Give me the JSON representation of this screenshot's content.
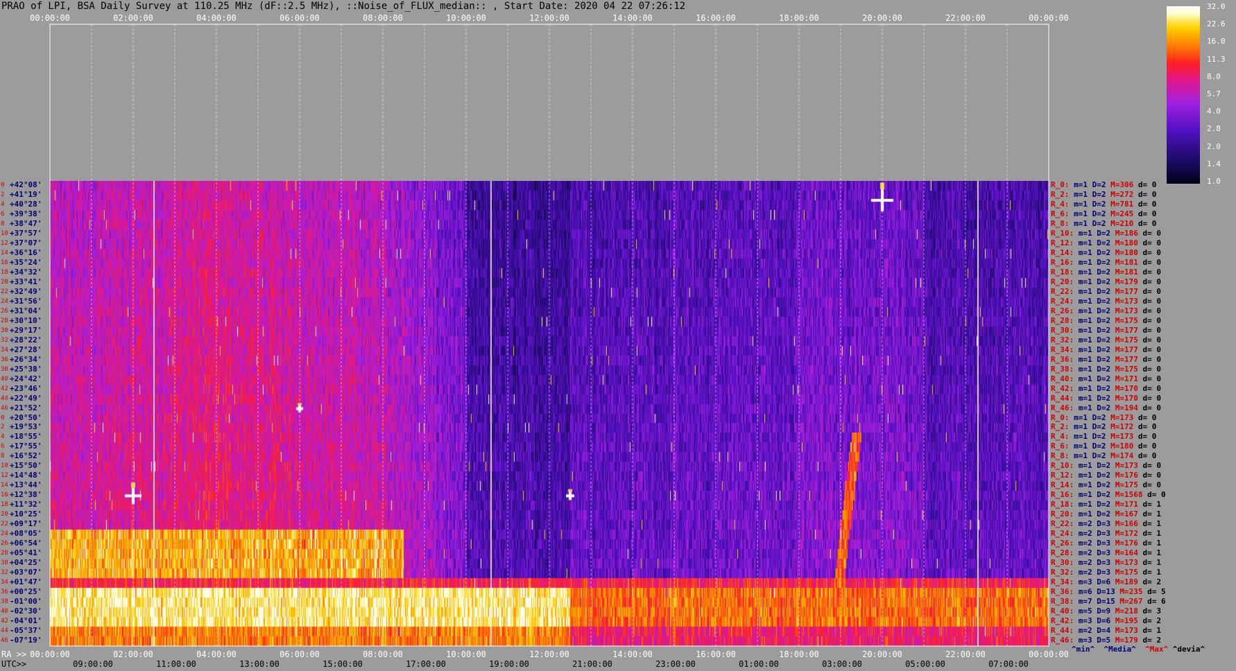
{
  "title": "PRAO of LPI, BSA Daily Survey at 110.25 MHz (dF::2.5 MHz), ::Noise_of_FLUX_median:: , Start Date: 2020 04 22 07:26:12",
  "top_axis_ticks": [
    "00:00:00",
    "02:00:00",
    "04:00:00",
    "06:00:00",
    "08:00:00",
    "10:00:00",
    "12:00:00",
    "14:00:00",
    "16:00:00",
    "18:00:00",
    "20:00:00",
    "22:00:00",
    "00:00:00"
  ],
  "ra_axis": {
    "label": "RA >>",
    "ticks": [
      "00:00:00",
      "02:00:00",
      "04:00:00",
      "06:00:00",
      "08:00:00",
      "10:00:00",
      "12:00:00",
      "14:00:00",
      "16:00:00",
      "18:00:00",
      "20:00:00",
      "22:00:00",
      "00:00:00"
    ]
  },
  "utc_axis": {
    "label": "UTC>>",
    "ticks": [
      "09:00:00",
      "11:00:00",
      "13:00:00",
      "15:00:00",
      "17:00:00",
      "19:00:00",
      "21:00:00",
      "23:00:00",
      "01:00:00",
      "03:00:00",
      "05:00:00",
      "07:00:00"
    ]
  },
  "colorbar": {
    "ticks": [
      "32.0",
      "22.6",
      "16.0",
      "11.3",
      "8.0",
      "5.7",
      "4.0",
      "2.8",
      "2.0",
      "1.4",
      "1.0"
    ]
  },
  "legend": {
    "min": "^min^",
    "media": "^Media^",
    "max": "^Max^",
    "devia": "^devia^"
  },
  "declinations": [
    "+42°08'",
    "+41°19'",
    "+40°28'",
    "+39°38'",
    "+38°47'",
    "+37°57'",
    "+37°07'",
    "+36°16'",
    "+35°24'",
    "+34°32'",
    "+33°41'",
    "+32°49'",
    "+31°56'",
    "+31°04'",
    "+30°10'",
    "+29°17'",
    "+28°22'",
    "+27°28'",
    "+26°34'",
    "+25°38'",
    "+24°42'",
    "+23°46'",
    "+22°49'",
    "+21°52'",
    "+20°50'",
    "+19°53'",
    "+18°55'",
    "+17°55'",
    "+16°52'",
    "+15°50'",
    "+14°48'",
    "+13°44'",
    "+12°38'",
    "+11°32'",
    "+10°25'",
    "+09°17'",
    "+08°05'",
    "+06°54'",
    "+05°41'",
    "+04°25'",
    "+03°07'",
    "+01°47'",
    "+00°25'",
    "-01°00'",
    "-02°30'",
    "-04°01'",
    "-05°37'",
    "-07°19'"
  ],
  "row_indices": [
    "0",
    "2",
    "4",
    "6",
    "8",
    "10",
    "12",
    "14",
    "16",
    "18",
    "20",
    "22",
    "24",
    "26",
    "28",
    "30",
    "32",
    "34",
    "36",
    "38",
    "40",
    "42",
    "44",
    "46",
    "0",
    "2",
    "4",
    "6",
    "8",
    "10",
    "12",
    "14",
    "16",
    "18",
    "20",
    "22",
    "24",
    "26",
    "28",
    "30",
    "32",
    "34",
    "36",
    "38",
    "40",
    "42",
    "44",
    "46"
  ],
  "row_stats": [
    {
      "r": "R_0:",
      "m": "m=1",
      "D": "D=2",
      "M": "M=306",
      "d": "d= 0"
    },
    {
      "r": "R_2:",
      "m": "m=1",
      "D": "D=2",
      "M": "M=272",
      "d": "d= 0"
    },
    {
      "r": "R_4:",
      "m": "m=1",
      "D": "D=2",
      "M": "M=781",
      "d": "d= 0"
    },
    {
      "r": "R_6:",
      "m": "m=1",
      "D": "D=2",
      "M": "M=245",
      "d": "d= 0"
    },
    {
      "r": "R_8:",
      "m": "m=1",
      "D": "D=2",
      "M": "M=210",
      "d": "d= 0"
    },
    {
      "r": "R_10:",
      "m": "m=1",
      "D": "D=2",
      "M": "M=186",
      "d": "d= 0"
    },
    {
      "r": "R_12:",
      "m": "m=1",
      "D": "D=2",
      "M": "M=180",
      "d": "d= 0"
    },
    {
      "r": "R_14:",
      "m": "m=1",
      "D": "D=2",
      "M": "M=180",
      "d": "d= 0"
    },
    {
      "r": "R_16:",
      "m": "m=1",
      "D": "D=2",
      "M": "M=181",
      "d": "d= 0"
    },
    {
      "r": "R_18:",
      "m": "m=1",
      "D": "D=2",
      "M": "M=181",
      "d": "d= 0"
    },
    {
      "r": "R_20:",
      "m": "m=1",
      "D": "D=2",
      "M": "M=179",
      "d": "d= 0"
    },
    {
      "r": "R_22:",
      "m": "m=1",
      "D": "D=2",
      "M": "M=177",
      "d": "d= 0"
    },
    {
      "r": "R_24:",
      "m": "m=1",
      "D": "D=2",
      "M": "M=173",
      "d": "d= 0"
    },
    {
      "r": "R_26:",
      "m": "m=1",
      "D": "D=2",
      "M": "M=173",
      "d": "d= 0"
    },
    {
      "r": "R_28:",
      "m": "m=1",
      "D": "D=2",
      "M": "M=175",
      "d": "d= 0"
    },
    {
      "r": "R_30:",
      "m": "m=1",
      "D": "D=2",
      "M": "M=177",
      "d": "d= 0"
    },
    {
      "r": "R_32:",
      "m": "m=1",
      "D": "D=2",
      "M": "M=175",
      "d": "d= 0"
    },
    {
      "r": "R_34:",
      "m": "m=1",
      "D": "D=2",
      "M": "M=177",
      "d": "d= 0"
    },
    {
      "r": "R_36:",
      "m": "m=1",
      "D": "D=2",
      "M": "M=177",
      "d": "d= 0"
    },
    {
      "r": "R_38:",
      "m": "m=1",
      "D": "D=2",
      "M": "M=175",
      "d": "d= 0"
    },
    {
      "r": "R_40:",
      "m": "m=1",
      "D": "D=2",
      "M": "M=171",
      "d": "d= 0"
    },
    {
      "r": "R_42:",
      "m": "m=1",
      "D": "D=2",
      "M": "M=170",
      "d": "d= 0"
    },
    {
      "r": "R_44:",
      "m": "m=1",
      "D": "D=2",
      "M": "M=170",
      "d": "d= 0"
    },
    {
      "r": "R_46:",
      "m": "m=1",
      "D": "D=2",
      "M": "M=194",
      "d": "d= 0"
    },
    {
      "r": "R_0:",
      "m": "m=1",
      "D": "D=2",
      "M": "M=173",
      "d": "d= 0"
    },
    {
      "r": "R_2:",
      "m": "m=1",
      "D": "D=2",
      "M": "M=172",
      "d": "d= 0"
    },
    {
      "r": "R_4:",
      "m": "m=1",
      "D": "D=2",
      "M": "M=173",
      "d": "d= 0"
    },
    {
      "r": "R_6:",
      "m": "m=1",
      "D": "D=2",
      "M": "M=180",
      "d": "d= 0"
    },
    {
      "r": "R_8:",
      "m": "m=1",
      "D": "D=2",
      "M": "M=174",
      "d": "d= 0"
    },
    {
      "r": "R_10:",
      "m": "m=1",
      "D": "D=2",
      "M": "M=173",
      "d": "d= 0"
    },
    {
      "r": "R_12:",
      "m": "m=1",
      "D": "D=2",
      "M": "M=176",
      "d": "d= 0"
    },
    {
      "r": "R_14:",
      "m": "m=1",
      "D": "D=2",
      "M": "M=175",
      "d": "d= 0"
    },
    {
      "r": "R_16:",
      "m": "m=1",
      "D": "D=2",
      "M": "M=1568",
      "d": "d= 0"
    },
    {
      "r": "R_18:",
      "m": "m=1",
      "D": "D=2",
      "M": "M=171",
      "d": "d= 1"
    },
    {
      "r": "R_20:",
      "m": "m=1",
      "D": "D=2",
      "M": "M=167",
      "d": "d= 1"
    },
    {
      "r": "R_22:",
      "m": "m=2",
      "D": "D=3",
      "M": "M=166",
      "d": "d= 1"
    },
    {
      "r": "R_24:",
      "m": "m=2",
      "D": "D=3",
      "M": "M=172",
      "d": "d= 1"
    },
    {
      "r": "R_26:",
      "m": "m=2",
      "D": "D=3",
      "M": "M=176",
      "d": "d= 1"
    },
    {
      "r": "R_28:",
      "m": "m=2",
      "D": "D=3",
      "M": "M=164",
      "d": "d= 1"
    },
    {
      "r": "R_30:",
      "m": "m=2",
      "D": "D=3",
      "M": "M=173",
      "d": "d= 1"
    },
    {
      "r": "R_32:",
      "m": "m=2",
      "D": "D=3",
      "M": "M=175",
      "d": "d= 1"
    },
    {
      "r": "R_34:",
      "m": "m=3",
      "D": "D=6",
      "M": "M=189",
      "d": "d= 2"
    },
    {
      "r": "R_36:",
      "m": "m=6",
      "D": "D=13",
      "M": "M=235",
      "d": "d= 5"
    },
    {
      "r": "R_38:",
      "m": "m=7",
      "D": "D=15",
      "M": "M=267",
      "d": "d= 6"
    },
    {
      "r": "R_40:",
      "m": "m=5",
      "D": "D=9",
      "M": "M=218",
      "d": "d= 3"
    },
    {
      "r": "R_42:",
      "m": "m=3",
      "D": "D=6",
      "M": "M=195",
      "d": "d= 2"
    },
    {
      "r": "R_44:",
      "m": "m=2",
      "D": "D=4",
      "M": "M=173",
      "d": "d= 1"
    },
    {
      "r": "R_46:",
      "m": "m=3",
      "D": "D=5",
      "M": "M=179",
      "d": "d= 2"
    }
  ],
  "chart_data": {
    "type": "heatmap",
    "title": "PRAO of LPI, BSA Daily Survey at 110.25 MHz (dF::2.5 MHz), ::Noise_of_FLUX_median:: , Start Date: 2020 04 22 07:26:12",
    "x_axis": "RA 00:00:00 – 24:00:00",
    "y_axis": "Declination +42°08' … -07°19' (48 beams)",
    "color_scale": "log",
    "color_range": [
      1.0,
      32.0
    ],
    "features": [
      {
        "name": "bright horizontal band",
        "dec_range": [
          "+00°25'",
          "-04°01'"
        ],
        "level": "22.6-32.0"
      },
      {
        "name": "warm band",
        "dec_range": [
          "+08°05'",
          "+03°07'"
        ],
        "ra_range": [
          "00:00",
          "08:00"
        ],
        "level": "8.0-16.0"
      },
      {
        "name": "point source",
        "ra": "20:00",
        "dec": "+41°19'",
        "level": "32.0"
      },
      {
        "name": "point source",
        "ra": "02:00",
        "dec": "+12°38'",
        "level": "32.0"
      },
      {
        "name": "diagonal streak",
        "ra_range": [
          "18:55",
          "19:35"
        ],
        "dec_range": [
          "+01°47'",
          "+18°55'"
        ],
        "level": "8.0-16.0"
      }
    ]
  }
}
